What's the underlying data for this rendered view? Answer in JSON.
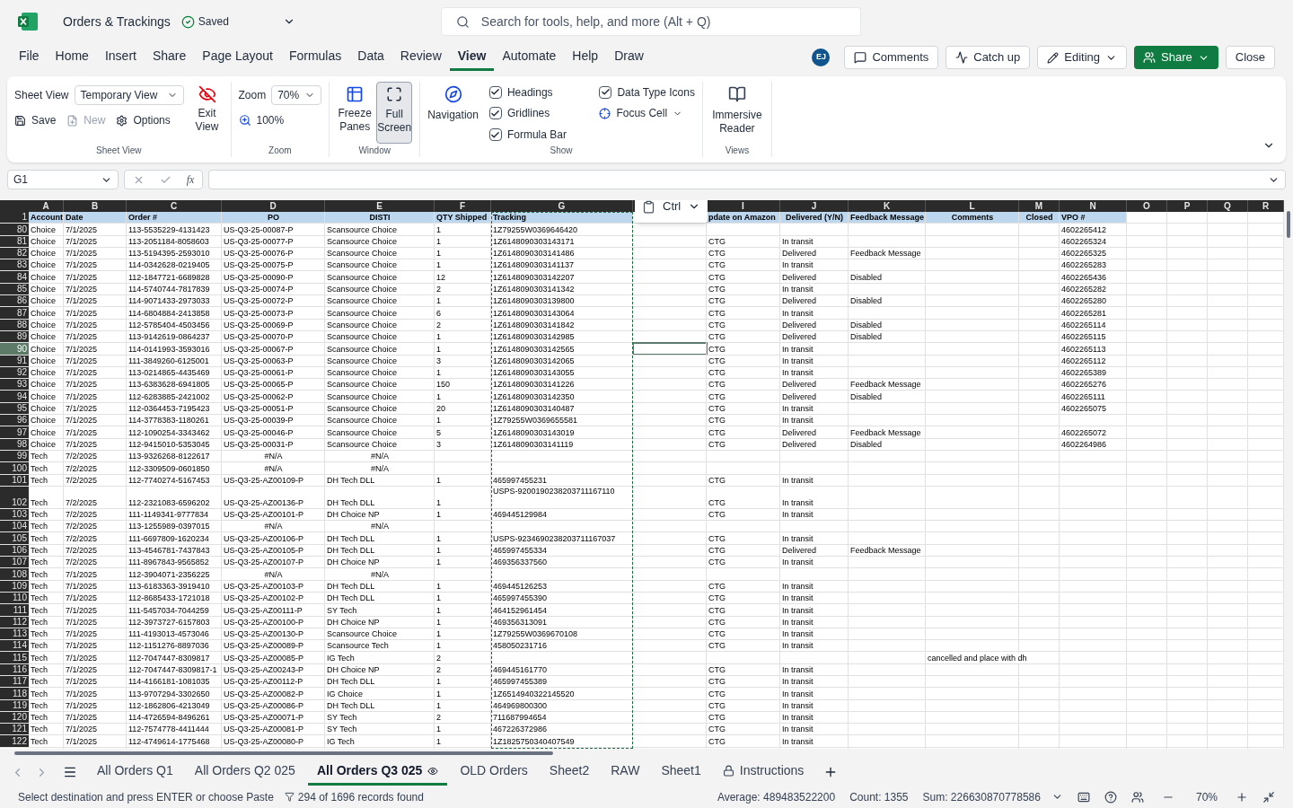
{
  "app": {
    "title": "Orders & Trackings",
    "save_status": "Saved"
  },
  "search": {
    "placeholder": "Search for tools, help, and more (Alt + Q)"
  },
  "menu_tabs": [
    {
      "label": "File",
      "selected": false
    },
    {
      "label": "Home",
      "selected": false
    },
    {
      "label": "Insert",
      "selected": false
    },
    {
      "label": "Share",
      "selected": false
    },
    {
      "label": "Page Layout",
      "selected": false
    },
    {
      "label": "Formulas",
      "selected": false
    },
    {
      "label": "Data",
      "selected": false
    },
    {
      "label": "Review",
      "selected": false
    },
    {
      "label": "View",
      "selected": true
    },
    {
      "label": "Automate",
      "selected": false
    },
    {
      "label": "Help",
      "selected": false
    },
    {
      "label": "Draw",
      "selected": false
    }
  ],
  "account": {
    "initials": "EJ"
  },
  "actions": [
    {
      "label": "Comments",
      "kind": "comments"
    },
    {
      "label": "Catch up",
      "kind": "catchup"
    },
    {
      "label": "Editing",
      "kind": "editing"
    },
    {
      "label": "Share",
      "kind": "share"
    },
    {
      "label": "Close",
      "kind": "close"
    }
  ],
  "ribbon": {
    "sheet_view": {
      "label": "Sheet View",
      "view_select": "Temporary View",
      "exit": "Exit View",
      "save": "Save",
      "new": {
        "label": "New",
        "disabled": true
      },
      "options": "Options",
      "group": "Sheet View"
    },
    "zoom": {
      "label": "Zoom",
      "value": "70%",
      "reset": "100%",
      "group": "Zoom"
    },
    "window": {
      "freeze": "Freeze Panes",
      "full_screen": {
        "label": "Full Screen",
        "pressed": true
      },
      "group": "Window"
    },
    "show": {
      "navigation": "Navigation",
      "checks": [
        {
          "label": "Headings",
          "checked": true
        },
        {
          "label": "Gridlines",
          "checked": true
        },
        {
          "label": "Formula Bar",
          "checked": true
        },
        {
          "label": "Data Type Icons",
          "checked": true
        }
      ],
      "focus_cell": "Focus Cell",
      "group": "Show"
    },
    "views": {
      "reader": "Immersive Reader",
      "group": "Views"
    }
  },
  "formula_bar": {
    "name_box": "G1",
    "function_label": "fx"
  },
  "paste_popup": {
    "label": "Ctrl"
  },
  "grid": {
    "columns_left_of_popup": [
      "A",
      "B",
      "C",
      "D",
      "E",
      "F",
      "G"
    ],
    "columns_right_of_popup": [
      "I",
      "J",
      "K",
      "L",
      "M",
      "N",
      "O",
      "P",
      "Q",
      "R"
    ],
    "header_row": {
      "number": "1",
      "cells": [
        "Account",
        "Date",
        "Order #",
        "PO",
        "DISTI",
        "QTY Shipped",
        "Tracking",
        null,
        "pdate on Amazon",
        "Delivered (Y/N)",
        "Feedback Message",
        "Comments",
        "Closed",
        "VPO #"
      ]
    },
    "rows": [
      {
        "number": "80",
        "selected": false,
        "cells": [
          "Choice",
          "7/1/2025",
          "113-5535229-4131423",
          "US-Q3-25-00087-P",
          "Scansource Choice",
          "1",
          "1Z79255W0369646420",
          null,
          null,
          null,
          null,
          null,
          null,
          "4602265412"
        ]
      },
      {
        "number": "81",
        "selected": false,
        "cells": [
          "Choice",
          "7/1/2025",
          "113-2051184-8058603",
          "US-Q3-25-00077-P",
          "Scansource Choice",
          "1",
          "1Z6148090303143171",
          null,
          "CTG",
          "In transit",
          null,
          null,
          null,
          "4602265324"
        ]
      },
      {
        "number": "82",
        "selected": false,
        "cells": [
          "Choice",
          "7/1/2025",
          "113-5194395-2593010",
          "US-Q3-25-00076-P",
          "Scansource Choice",
          "1",
          "1Z6148090303141486",
          null,
          "CTG",
          "Delivered",
          "Feedback Message",
          null,
          null,
          "4602265325"
        ]
      },
      {
        "number": "83",
        "selected": false,
        "cells": [
          "Choice",
          "7/1/2025",
          "114-0342628-0219405",
          "US-Q3-25-00075-P",
          "Scansource Choice",
          "1",
          "1Z6148090303141137",
          null,
          "CTG",
          "In transit",
          null,
          null,
          null,
          "4602265283"
        ]
      },
      {
        "number": "84",
        "selected": false,
        "cells": [
          "Choice",
          "7/1/2025",
          "112-1847721-6689828",
          "US-Q3-25-00090-P",
          "Scansource Choice",
          "12",
          "1Z6148090303142207",
          null,
          "CTG",
          "Delivered",
          "Disabled",
          null,
          null,
          "4602265436"
        ]
      },
      {
        "number": "85",
        "selected": false,
        "cells": [
          "Choice",
          "7/1/2025",
          "114-5740744-7817839",
          "US-Q3-25-00074-P",
          "Scansource Choice",
          "2",
          "1Z6148090303141342",
          null,
          "CTG",
          "In transit",
          null,
          null,
          null,
          "4602265282"
        ]
      },
      {
        "number": "86",
        "selected": false,
        "cells": [
          "Choice",
          "7/1/2025",
          "114-9071433-2973033",
          "US-Q3-25-00072-P",
          "Scansource Choice",
          "1",
          "1Z6148090303139800",
          null,
          "CTG",
          "Delivered",
          "Disabled",
          null,
          null,
          "4602265280"
        ]
      },
      {
        "number": "87",
        "selected": false,
        "cells": [
          "Choice",
          "7/1/2025",
          "114-6804884-2413858",
          "US-Q3-25-00073-P",
          "Scansource Choice",
          "6",
          "1Z6148090303143064",
          null,
          "CTG",
          "In transit",
          null,
          null,
          null,
          "4602265281"
        ]
      },
      {
        "number": "88",
        "selected": false,
        "cells": [
          "Choice",
          "7/1/2025",
          "112-5785404-4503456",
          "US-Q3-25-00069-P",
          "Scansource Choice",
          "2",
          "1Z6148090303141842",
          null,
          "CTG",
          "Delivered",
          "Disabled",
          null,
          null,
          "4602265114"
        ]
      },
      {
        "number": "89",
        "selected": false,
        "cells": [
          "Choice",
          "7/1/2025",
          "113-9142619-0864237",
          "US-Q3-25-00070-P",
          "Scansource Choice",
          "1",
          "1Z6148090303142985",
          null,
          "CTG",
          "Delivered",
          "Disabled",
          null,
          null,
          "4602265115"
        ]
      },
      {
        "number": "90",
        "selected": true,
        "cells": [
          "Choice",
          "7/1/2025",
          "114-0141993-3593016",
          "US-Q3-25-00067-P",
          "Scansource Choice",
          "1",
          "1Z6148090303142565",
          null,
          "CTG",
          "In transit",
          null,
          null,
          null,
          "4602265113"
        ]
      },
      {
        "number": "91",
        "selected": false,
        "cells": [
          "Choice",
          "7/1/2025",
          "111-3849260-6125001",
          "US-Q3-25-00063-P",
          "Scansource Choice",
          "3",
          "1Z6148090303142065",
          null,
          "CTG",
          "In transit",
          null,
          null,
          null,
          "4602265112"
        ]
      },
      {
        "number": "92",
        "selected": false,
        "cells": [
          "Choice",
          "7/1/2025",
          "113-0214865-4435469",
          "US-Q3-25-00061-P",
          "Scansource Choice",
          "1",
          "1Z6148090303143055",
          null,
          "CTG",
          "In transit",
          null,
          null,
          null,
          "4602265389"
        ]
      },
      {
        "number": "93",
        "selected": false,
        "cells": [
          "Choice",
          "7/1/2025",
          "113-6383628-6941805",
          "US-Q3-25-00065-P",
          "Scansource Choice",
          "150",
          "1Z6148090303141226",
          null,
          "CTG",
          "Delivered",
          "Feedback Message",
          null,
          null,
          "4602265276"
        ]
      },
      {
        "number": "94",
        "selected": false,
        "cells": [
          "Choice",
          "7/1/2025",
          "112-6283885-2421002",
          "US-Q3-25-00062-P",
          "Scansource Choice",
          "1",
          "1Z6148090303142350",
          null,
          "CTG",
          "Delivered",
          "Disabled",
          null,
          null,
          "4602265111"
        ]
      },
      {
        "number": "95",
        "selected": false,
        "cells": [
          "Choice",
          "7/1/2025",
          "112-0364453-7195423",
          "US-Q3-25-00051-P",
          "Scansource Choice",
          "20",
          "1Z6148090303140487",
          null,
          "CTG",
          "In transit",
          null,
          null,
          null,
          "4602265075"
        ]
      },
      {
        "number": "96",
        "selected": false,
        "cells": [
          "Choice",
          "7/1/2025",
          "114-3778383-1180261",
          "US-Q3-25-00039-P",
          "Scansource Choice",
          "1",
          "1Z79255W0369655581",
          null,
          "CTG",
          "In transit",
          null,
          null,
          null,
          null
        ]
      },
      {
        "number": "97",
        "selected": false,
        "cells": [
          "Choice",
          "7/1/2025",
          "112-1090254-3343462",
          "US-Q3-25-00046-P",
          "Scansource Choice",
          "5",
          "1Z6148090303143019",
          null,
          "CTG",
          "Delivered",
          "Feedback Message",
          null,
          null,
          "4602265072"
        ]
      },
      {
        "number": "98",
        "selected": false,
        "cells": [
          "Choice",
          "7/1/2025",
          "112-9415010-5353045",
          "US-Q3-25-00031-P",
          "Scansource Choice",
          "3",
          "1Z6148090303141119",
          null,
          "CTG",
          "Delivered",
          "Disabled",
          null,
          null,
          "4602264986"
        ]
      },
      {
        "number": "99",
        "selected": false,
        "cells": [
          "Tech",
          "7/2/2025",
          "113-9326268-8122617",
          {
            "text": "#N/A",
            "kind": "error"
          },
          {
            "text": "#N/A",
            "kind": "error"
          },
          null,
          null,
          null,
          null,
          null,
          null,
          null,
          null,
          null
        ]
      },
      {
        "number": "100",
        "selected": false,
        "cells": [
          "Tech",
          "7/2/2025",
          "112-3309509-0601850",
          {
            "text": "#N/A",
            "kind": "error"
          },
          {
            "text": "#N/A",
            "kind": "error"
          },
          null,
          null,
          null,
          null,
          null,
          null,
          null,
          null,
          null
        ]
      },
      {
        "number": "101",
        "selected": false,
        "cells": [
          "Tech",
          "7/2/2025",
          "112-7740274-5167453",
          "US-Q3-25-AZ00109-P",
          "DH Tech DLL",
          "1",
          "465997455231",
          null,
          "CTG",
          "In transit",
          null,
          null,
          null,
          null
        ]
      },
      {
        "number": "102",
        "selected": false,
        "cells": [
          "Tech",
          "7/2/2025",
          "112-2321083-6596202",
          "US-Q3-25-AZ00136-P",
          "DH Tech DLL",
          "1",
          {
            "text": "USPS-9200190238203711167110",
            "kind": "multiline"
          },
          null,
          "CTG",
          "In transit",
          null,
          null,
          null,
          null
        ]
      },
      {
        "number": "103",
        "selected": false,
        "cells": [
          "Tech",
          "7/2/2025",
          "111-1149341-9777834",
          "US-Q3-25-AZ00101-P",
          "DH Choice NP",
          "1",
          "469445129984",
          null,
          "CTG",
          "In transit",
          null,
          null,
          null,
          null
        ]
      },
      {
        "number": "104",
        "selected": false,
        "cells": [
          "Tech",
          "7/2/2025",
          "113-1255989-0397015",
          {
            "text": "#N/A",
            "kind": "error"
          },
          {
            "text": "#N/A",
            "kind": "error"
          },
          null,
          null,
          null,
          null,
          null,
          null,
          null,
          null,
          null
        ]
      },
      {
        "number": "105",
        "selected": false,
        "cells": [
          "Tech",
          "7/2/2025",
          "111-6697809-1620234",
          "US-Q3-25-AZ00106-P",
          "DH Tech DLL",
          "1",
          "USPS-9234690238203711167037",
          null,
          "CTG",
          "In transit",
          null,
          null,
          null,
          null
        ]
      },
      {
        "number": "106",
        "selected": false,
        "cells": [
          "Tech",
          "7/2/2025",
          "113-4546781-7437843",
          "US-Q3-25-AZ00105-P",
          "DH Tech DLL",
          "1",
          "465997455334",
          null,
          "CTG",
          "Delivered",
          "Feedback Message",
          null,
          null,
          null
        ]
      },
      {
        "number": "107",
        "selected": false,
        "cells": [
          "Tech",
          "7/2/2025",
          "111-8967843-9565852",
          "US-Q3-25-AZ00107-P",
          "DH Choice NP",
          "1",
          "469356337560",
          null,
          "CTG",
          "In transit",
          null,
          null,
          null,
          null
        ]
      },
      {
        "number": "108",
        "selected": false,
        "cells": [
          "Tech",
          "7/1/2025",
          "112-3904071-2356225",
          {
            "text": "#N/A",
            "kind": "error"
          },
          {
            "text": "#N/A",
            "kind": "error"
          },
          null,
          null,
          null,
          null,
          null,
          null,
          null,
          null,
          null
        ]
      },
      {
        "number": "109",
        "selected": false,
        "cells": [
          "Tech",
          "7/1/2025",
          "113-6183363-3919410",
          "US-Q3-25-AZ00103-P",
          "DH Tech DLL",
          "1",
          "469445126253",
          null,
          "CTG",
          "In transit",
          null,
          null,
          null,
          null
        ]
      },
      {
        "number": "110",
        "selected": false,
        "cells": [
          "Tech",
          "7/1/2025",
          "112-8685433-1721018",
          "US-Q3-25-AZ00102-P",
          "DH Tech DLL",
          "1",
          "465997455390",
          null,
          "CTG",
          "In transit",
          null,
          null,
          null,
          null
        ]
      },
      {
        "number": "111",
        "selected": false,
        "cells": [
          "Tech",
          "7/1/2025",
          "111-5457034-7044259",
          "US-Q3-25-AZ00111-P",
          "SY Tech",
          "1",
          "464152961454",
          null,
          "CTG",
          "In transit",
          null,
          null,
          null,
          null
        ]
      },
      {
        "number": "112",
        "selected": false,
        "cells": [
          "Tech",
          "7/1/2025",
          "112-3973727-6157803",
          "US-Q3-25-AZ00100-P",
          "DH Choice NP",
          "1",
          "469356313091",
          null,
          "CTG",
          "In transit",
          null,
          null,
          null,
          null
        ]
      },
      {
        "number": "113",
        "selected": false,
        "cells": [
          "Tech",
          "7/1/2025",
          "111-4193013-4573046",
          "US-Q3-25-AZ00130-P",
          "Scansource Choice",
          "1",
          "1Z79255W0369670108",
          null,
          "CTG",
          "In transit",
          null,
          null,
          null,
          null
        ]
      },
      {
        "number": "114",
        "selected": false,
        "cells": [
          "Tech",
          "7/1/2025",
          "112-1151276-8897036",
          "US-Q3-25-AZ00089-P",
          "Scansource Tech",
          "1",
          "458050231716",
          null,
          "CTG",
          "In transit",
          null,
          null,
          null,
          null
        ]
      },
      {
        "number": "115",
        "selected": false,
        "cells": [
          "Tech",
          "7/1/2025",
          "112-7047447-8309817",
          "US-Q3-25-AZ00085-P",
          "IG Tech",
          "2",
          null,
          null,
          null,
          null,
          null,
          "cancelled and place with dh",
          null,
          null
        ]
      },
      {
        "number": "116",
        "selected": false,
        "cells": [
          "Tech",
          "7/1/2025",
          "112-7047447-8309817-1",
          "US-Q3-25-AZ00243-P",
          "DH Choice NP",
          "2",
          "469445161770",
          null,
          "CTG",
          "In transit",
          null,
          null,
          null,
          null
        ]
      },
      {
        "number": "117",
        "selected": false,
        "cells": [
          "Tech",
          "7/1/2025",
          "114-4166181-1081035",
          "US-Q3-25-AZ00112-P",
          "DH Tech DLL",
          "1",
          "465997455389",
          null,
          "CTG",
          "In transit",
          null,
          null,
          null,
          null
        ]
      },
      {
        "number": "118",
        "selected": false,
        "cells": [
          "Tech",
          "7/1/2025",
          "113-9707294-3302650",
          "US-Q3-25-AZ00082-P",
          "IG Choice",
          "1",
          "1Z6514940322145520",
          null,
          "CTG",
          "In transit",
          null,
          null,
          null,
          null
        ]
      },
      {
        "number": "119",
        "selected": false,
        "cells": [
          "Tech",
          "7/1/2025",
          "112-1862806-4213049",
          "US-Q3-25-AZ00086-P",
          "DH Tech DLL",
          "1",
          "464969800300",
          null,
          "CTG",
          "In transit",
          null,
          null,
          null,
          null
        ]
      },
      {
        "number": "120",
        "selected": false,
        "cells": [
          "Tech",
          "7/1/2025",
          "114-4726594-8496261",
          "US-Q3-25-AZ00071-P",
          "SY Tech",
          "2",
          "711687994654",
          null,
          "CTG",
          "In transit",
          null,
          null,
          null,
          null
        ]
      },
      {
        "number": "121",
        "selected": false,
        "cells": [
          "Tech",
          "7/1/2025",
          "112-7574778-4411444",
          "US-Q3-25-AZ00081-P",
          "SY Tech",
          "1",
          "467226372986",
          null,
          "CTG",
          "In transit",
          null,
          null,
          null,
          null
        ]
      },
      {
        "number": "122",
        "selected": false,
        "cells": [
          "Tech",
          "7/1/2025",
          "112-4749614-1775468",
          "US-Q3-25-AZ00080-P",
          "IG Tech",
          "1",
          "1Z1825750340407549",
          null,
          "CTG",
          "In transit",
          null,
          null,
          null,
          null
        ]
      }
    ]
  },
  "sheet_tabs": [
    {
      "label": "All Orders Q1",
      "selected": false,
      "kind": "plain"
    },
    {
      "label": "All Orders Q2 025",
      "selected": false,
      "kind": "plain"
    },
    {
      "label": "All Orders Q3 025",
      "selected": true,
      "kind": "watched"
    },
    {
      "label": "OLD Orders",
      "selected": false,
      "kind": "plain"
    },
    {
      "label": "Sheet2",
      "selected": false,
      "kind": "plain"
    },
    {
      "label": "RAW",
      "selected": false,
      "kind": "plain"
    },
    {
      "label": "Sheet1",
      "selected": false,
      "kind": "plain"
    },
    {
      "label": "Instructions",
      "selected": false,
      "kind": "locked"
    }
  ],
  "status_bar": {
    "message": "Select destination and press ENTER or choose Paste",
    "filter": "294 of 1696 records found",
    "average": "Average: 489483522200",
    "count": "Count: 1355",
    "sum": "Sum: 226630870778586",
    "zoom": "70%"
  }
}
